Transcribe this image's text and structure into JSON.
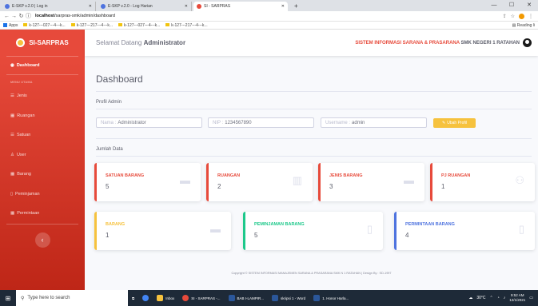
{
  "browser": {
    "tabs": [
      {
        "title": "E-SKP v.2.0 | Log in"
      },
      {
        "title": "E-SKP v.2.0 - Log Harian"
      },
      {
        "title": "SI - SARPRAS"
      }
    ],
    "new_tab": "+",
    "url_host": "localhost",
    "url_path": "/sarpras-smk/admin/dashboard",
    "bookmarks": [
      "Apps",
      "k-127---027---4---k...",
      "k-127---217---4---k...",
      "k-127---027---4---k...",
      "k-127---217---4---k..."
    ],
    "reading_list": "Reading li"
  },
  "sidebar": {
    "brand": "SI-SARPRAS",
    "dashboard": "Dashboard",
    "heading": "MENU UTAMA",
    "items": [
      {
        "label": "Jenis"
      },
      {
        "label": "Ruangan"
      },
      {
        "label": "Satuan"
      },
      {
        "label": "User"
      },
      {
        "label": "Barang"
      },
      {
        "label": "Peminjaman"
      },
      {
        "label": "Permintaan"
      }
    ],
    "toggle": "‹"
  },
  "topbar": {
    "welcome_prefix": "Selamat Datang",
    "welcome_name": "Administrator",
    "system_name": "SISTEM INFORMASI SARANA & PRASARANA",
    "school": "SMK NEGERI 1 RATAHAN"
  },
  "page": {
    "title": "Dashboard",
    "profile_heading": "Profil Admin",
    "fields": {
      "nama_label": "Nama :",
      "nama_value": "Administrator",
      "nip_label": "NIP :",
      "nip_value": "1234567890",
      "username_label": "Username :",
      "username_value": "admin"
    },
    "edit_button": "Ubah Profil",
    "data_heading": "Jumlah Data",
    "cards": [
      {
        "title": "SATUAN BARANG",
        "value": "5",
        "color": "#e74a3b",
        "icon": "box-icon"
      },
      {
        "title": "RUANGAN",
        "value": "2",
        "color": "#e74a3b",
        "icon": "building-icon"
      },
      {
        "title": "JENIS BARANG",
        "value": "3",
        "color": "#e74a3b",
        "icon": "box-icon"
      },
      {
        "title": "PJ RUANGAN",
        "value": "1",
        "color": "#e74a3b",
        "icon": "users-icon"
      },
      {
        "title": "BARANG",
        "value": "1",
        "color": "#f6c23e",
        "icon": "box-icon"
      },
      {
        "title": "PEMINJAMAN BARANG",
        "value": "5",
        "color": "#1cc88a",
        "icon": "file-icon"
      },
      {
        "title": "PERMINTAAN BARANG",
        "value": "4",
        "color": "#4e73df",
        "icon": "file-icon"
      }
    ],
    "footer": "Copyright © SISTEM INFORMASI MANAJEMEN SARANA & PRASARANA SMK N 1 RATAHAN | Design By : SD-1997"
  },
  "taskbar": {
    "search_placeholder": "Type here to search",
    "apps": [
      {
        "label": "Inbox",
        "color": "#f6c23e"
      },
      {
        "label": "SI - SARPRAS -...",
        "color": "#e74a3b"
      },
      {
        "label": "BAB I-LAMPIR...",
        "color": "#2b579a"
      },
      {
        "label": "skripsi 1 - Word",
        "color": "#2b579a"
      },
      {
        "label": "1. Honor Harla...",
        "color": "#2b579a"
      }
    ],
    "weather": "30°C",
    "time": "9:52 AM",
    "date": "12/1/2021"
  }
}
